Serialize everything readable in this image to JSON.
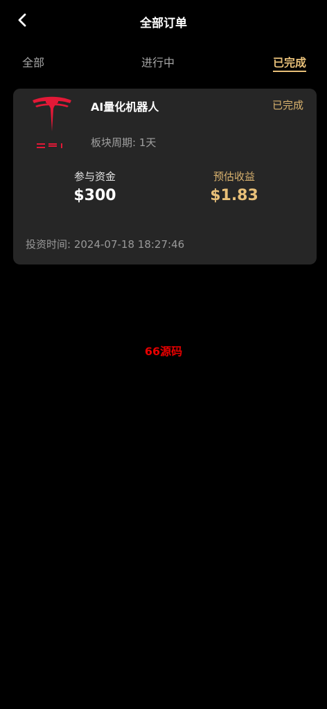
{
  "header": {
    "title": "全部订单"
  },
  "tabs": [
    {
      "label": "全部"
    },
    {
      "label": "进行中"
    },
    {
      "label": "已完成",
      "active": true
    }
  ],
  "order": {
    "product_name": "AI量化机器人",
    "status": "已完成",
    "period": "板块周期: 1天",
    "capital_label": "参与资金",
    "capital_value": "$300",
    "earnings_label": "预估收益",
    "earnings_value": "$1.83",
    "invest_time_label": "投资时间:",
    "invest_time_value": "2024-07-18 18:27:46"
  },
  "watermark": "66源码",
  "colors": {
    "background": "#000000",
    "card": "#262626",
    "accent_gold": "#e8c079",
    "logo_red": "#e31937"
  },
  "icons": {
    "back": "chevron-left-icon",
    "logo": "tesla-logo"
  }
}
